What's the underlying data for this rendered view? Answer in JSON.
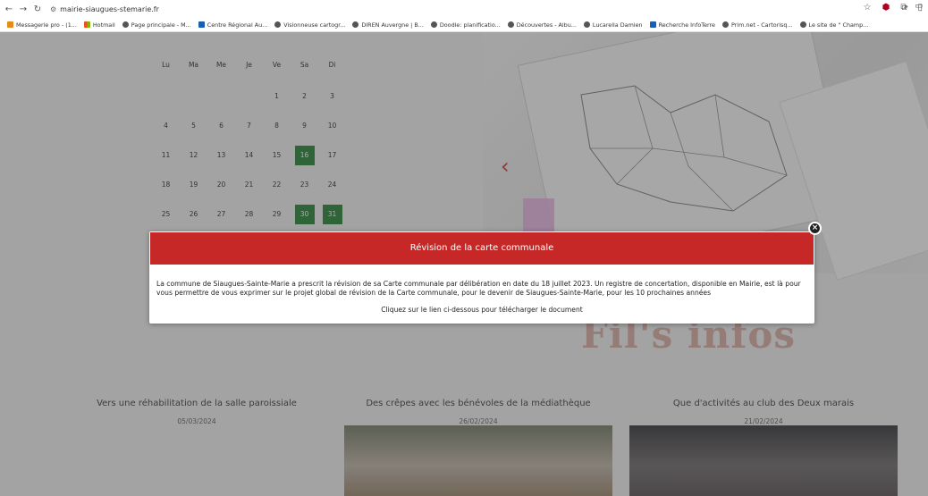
{
  "browser": {
    "url": "mairie-siaugues-stemarie.fr",
    "bookmarks": [
      {
        "label": "Messagerie pro - (1...",
        "icon": "mail-icon"
      },
      {
        "label": "Hotmail",
        "icon": "grid-icon"
      },
      {
        "label": "Page principale - M...",
        "icon": "globe-icon"
      },
      {
        "label": "Centre Régional Au...",
        "icon": "site-icon"
      },
      {
        "label": "Visionneuse cartogr...",
        "icon": "globe-icon"
      },
      {
        "label": "DIREN Auvergne | B...",
        "icon": "globe-icon"
      },
      {
        "label": "Doodle: planificatio...",
        "icon": "doodle-icon"
      },
      {
        "label": "Découvertes - Albu...",
        "icon": "globe-icon"
      },
      {
        "label": "Lucarella Damien",
        "icon": "globe-icon"
      },
      {
        "label": "Recherche InfoTerre",
        "icon": "site-icon"
      },
      {
        "label": "Prim.net - Cartorisq...",
        "icon": "globe-icon"
      },
      {
        "label": "Le site de \" Champ...",
        "icon": "globe-icon"
      }
    ],
    "more": "»"
  },
  "calendar": {
    "days": [
      "Lu",
      "Ma",
      "Me",
      "Je",
      "Ve",
      "Sa",
      "Di"
    ],
    "weeks": [
      [
        "",
        "",
        "",
        "",
        "1",
        "2",
        "3"
      ],
      [
        "4",
        "5",
        "6",
        "7",
        "8",
        "9",
        "10"
      ],
      [
        "11",
        "12",
        "13",
        "14",
        "15",
        "16",
        "17"
      ],
      [
        "18",
        "19",
        "20",
        "21",
        "22",
        "23",
        "24"
      ],
      [
        "25",
        "26",
        "27",
        "28",
        "29",
        "30",
        "31"
      ]
    ],
    "highlight": [
      "16",
      "30",
      "31"
    ]
  },
  "site": {
    "bigtitle": "Fil's infos",
    "news": [
      {
        "title": "Vers une réhabilitation de la salle paroissiale",
        "date": "05/03/2024"
      },
      {
        "title": "Des crêpes avec les bénévoles de la médiathèque",
        "date": "26/02/2024"
      },
      {
        "title": "Que d'activités au club des Deux marais",
        "date": "21/02/2024"
      }
    ]
  },
  "modal": {
    "title": "Révision de la carte communale",
    "body": "La commune de Siaugues-Sainte-Marie a prescrit la révision de sa Carte communale par délibération en date du 18 juillet 2023. Un registre de concertation, disponible en Mairie, est là pour vous permettre de vous exprimer sur le projet global de révision de la Carte communale, pour le devenir de Siaugues-Sainte-Marie, pour les 10 prochaines années",
    "link": "Cliquez sur le lien ci-dessous pour télécharger le document",
    "close": "×"
  },
  "colors": {
    "accent": "#c62828",
    "highlight": "#1d7a2d"
  }
}
